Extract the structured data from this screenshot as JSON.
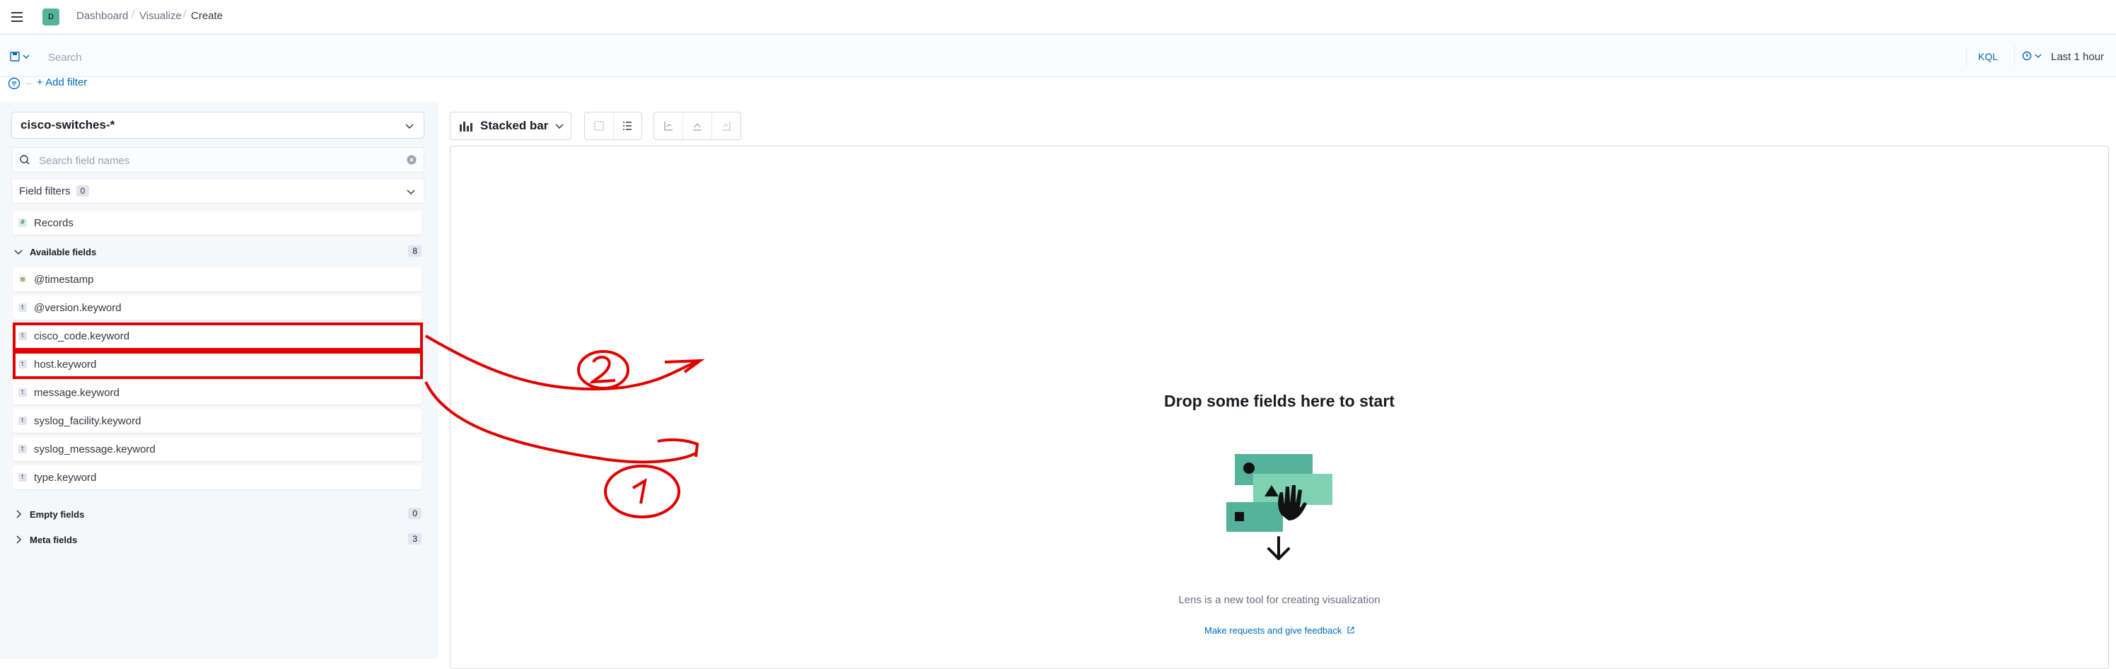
{
  "header": {
    "space_initial": "D",
    "breadcrumbs": [
      "Dashboard",
      "Visualize",
      "Create"
    ]
  },
  "query_bar": {
    "search_placeholder": "Search",
    "language": "KQL",
    "date_range": "Last 1 hour",
    "add_filter": "+ Add filter"
  },
  "sidebar": {
    "index_pattern": "cisco-switches-*",
    "field_search_placeholder": "Search field names",
    "field_filters": {
      "label": "Field filters",
      "count": "0"
    },
    "records": "Records",
    "available": {
      "label": "Available fields",
      "count": "8"
    },
    "fields": [
      {
        "name": "@timestamp",
        "type": "date"
      },
      {
        "name": "@version.keyword",
        "type": "string"
      },
      {
        "name": "cisco_code.keyword",
        "type": "string"
      },
      {
        "name": "host.keyword",
        "type": "string"
      },
      {
        "name": "message.keyword",
        "type": "string"
      },
      {
        "name": "syslog_facility.keyword",
        "type": "string"
      },
      {
        "name": "syslog_message.keyword",
        "type": "string"
      },
      {
        "name": "type.keyword",
        "type": "string"
      }
    ],
    "empty_fields": {
      "label": "Empty fields",
      "count": "0"
    },
    "meta_fields": {
      "label": "Meta fields",
      "count": "3"
    }
  },
  "workspace": {
    "chart_type": "Stacked bar",
    "drop_title": "Drop some fields here to start",
    "lens_description": "Lens is a new tool for creating visualization",
    "feedback_link": "Make requests and give feedback"
  },
  "colors": {
    "accent": "#006bb8",
    "annotation": "#e00000",
    "illustration_green": "#54b399"
  }
}
